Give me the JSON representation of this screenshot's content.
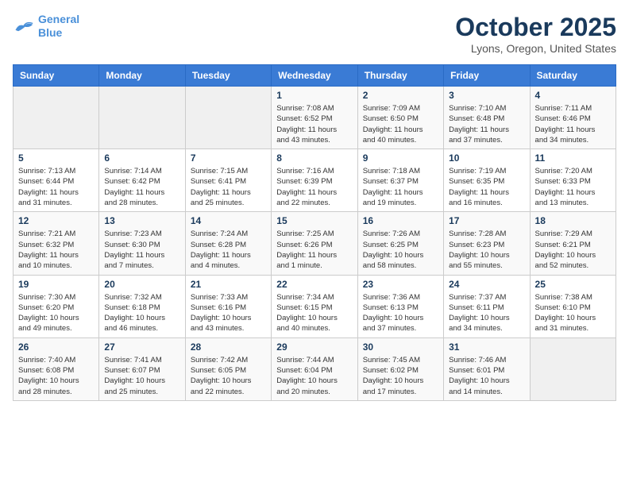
{
  "logo": {
    "line1": "General",
    "line2": "Blue"
  },
  "title": "October 2025",
  "location": "Lyons, Oregon, United States",
  "headers": [
    "Sunday",
    "Monday",
    "Tuesday",
    "Wednesday",
    "Thursday",
    "Friday",
    "Saturday"
  ],
  "weeks": [
    [
      {
        "day": "",
        "info": ""
      },
      {
        "day": "",
        "info": ""
      },
      {
        "day": "",
        "info": ""
      },
      {
        "day": "1",
        "info": "Sunrise: 7:08 AM\nSunset: 6:52 PM\nDaylight: 11 hours\nand 43 minutes."
      },
      {
        "day": "2",
        "info": "Sunrise: 7:09 AM\nSunset: 6:50 PM\nDaylight: 11 hours\nand 40 minutes."
      },
      {
        "day": "3",
        "info": "Sunrise: 7:10 AM\nSunset: 6:48 PM\nDaylight: 11 hours\nand 37 minutes."
      },
      {
        "day": "4",
        "info": "Sunrise: 7:11 AM\nSunset: 6:46 PM\nDaylight: 11 hours\nand 34 minutes."
      }
    ],
    [
      {
        "day": "5",
        "info": "Sunrise: 7:13 AM\nSunset: 6:44 PM\nDaylight: 11 hours\nand 31 minutes."
      },
      {
        "day": "6",
        "info": "Sunrise: 7:14 AM\nSunset: 6:42 PM\nDaylight: 11 hours\nand 28 minutes."
      },
      {
        "day": "7",
        "info": "Sunrise: 7:15 AM\nSunset: 6:41 PM\nDaylight: 11 hours\nand 25 minutes."
      },
      {
        "day": "8",
        "info": "Sunrise: 7:16 AM\nSunset: 6:39 PM\nDaylight: 11 hours\nand 22 minutes."
      },
      {
        "day": "9",
        "info": "Sunrise: 7:18 AM\nSunset: 6:37 PM\nDaylight: 11 hours\nand 19 minutes."
      },
      {
        "day": "10",
        "info": "Sunrise: 7:19 AM\nSunset: 6:35 PM\nDaylight: 11 hours\nand 16 minutes."
      },
      {
        "day": "11",
        "info": "Sunrise: 7:20 AM\nSunset: 6:33 PM\nDaylight: 11 hours\nand 13 minutes."
      }
    ],
    [
      {
        "day": "12",
        "info": "Sunrise: 7:21 AM\nSunset: 6:32 PM\nDaylight: 11 hours\nand 10 minutes."
      },
      {
        "day": "13",
        "info": "Sunrise: 7:23 AM\nSunset: 6:30 PM\nDaylight: 11 hours\nand 7 minutes."
      },
      {
        "day": "14",
        "info": "Sunrise: 7:24 AM\nSunset: 6:28 PM\nDaylight: 11 hours\nand 4 minutes."
      },
      {
        "day": "15",
        "info": "Sunrise: 7:25 AM\nSunset: 6:26 PM\nDaylight: 11 hours\nand 1 minute."
      },
      {
        "day": "16",
        "info": "Sunrise: 7:26 AM\nSunset: 6:25 PM\nDaylight: 10 hours\nand 58 minutes."
      },
      {
        "day": "17",
        "info": "Sunrise: 7:28 AM\nSunset: 6:23 PM\nDaylight: 10 hours\nand 55 minutes."
      },
      {
        "day": "18",
        "info": "Sunrise: 7:29 AM\nSunset: 6:21 PM\nDaylight: 10 hours\nand 52 minutes."
      }
    ],
    [
      {
        "day": "19",
        "info": "Sunrise: 7:30 AM\nSunset: 6:20 PM\nDaylight: 10 hours\nand 49 minutes."
      },
      {
        "day": "20",
        "info": "Sunrise: 7:32 AM\nSunset: 6:18 PM\nDaylight: 10 hours\nand 46 minutes."
      },
      {
        "day": "21",
        "info": "Sunrise: 7:33 AM\nSunset: 6:16 PM\nDaylight: 10 hours\nand 43 minutes."
      },
      {
        "day": "22",
        "info": "Sunrise: 7:34 AM\nSunset: 6:15 PM\nDaylight: 10 hours\nand 40 minutes."
      },
      {
        "day": "23",
        "info": "Sunrise: 7:36 AM\nSunset: 6:13 PM\nDaylight: 10 hours\nand 37 minutes."
      },
      {
        "day": "24",
        "info": "Sunrise: 7:37 AM\nSunset: 6:11 PM\nDaylight: 10 hours\nand 34 minutes."
      },
      {
        "day": "25",
        "info": "Sunrise: 7:38 AM\nSunset: 6:10 PM\nDaylight: 10 hours\nand 31 minutes."
      }
    ],
    [
      {
        "day": "26",
        "info": "Sunrise: 7:40 AM\nSunset: 6:08 PM\nDaylight: 10 hours\nand 28 minutes."
      },
      {
        "day": "27",
        "info": "Sunrise: 7:41 AM\nSunset: 6:07 PM\nDaylight: 10 hours\nand 25 minutes."
      },
      {
        "day": "28",
        "info": "Sunrise: 7:42 AM\nSunset: 6:05 PM\nDaylight: 10 hours\nand 22 minutes."
      },
      {
        "day": "29",
        "info": "Sunrise: 7:44 AM\nSunset: 6:04 PM\nDaylight: 10 hours\nand 20 minutes."
      },
      {
        "day": "30",
        "info": "Sunrise: 7:45 AM\nSunset: 6:02 PM\nDaylight: 10 hours\nand 17 minutes."
      },
      {
        "day": "31",
        "info": "Sunrise: 7:46 AM\nSunset: 6:01 PM\nDaylight: 10 hours\nand 14 minutes."
      },
      {
        "day": "",
        "info": ""
      }
    ]
  ]
}
